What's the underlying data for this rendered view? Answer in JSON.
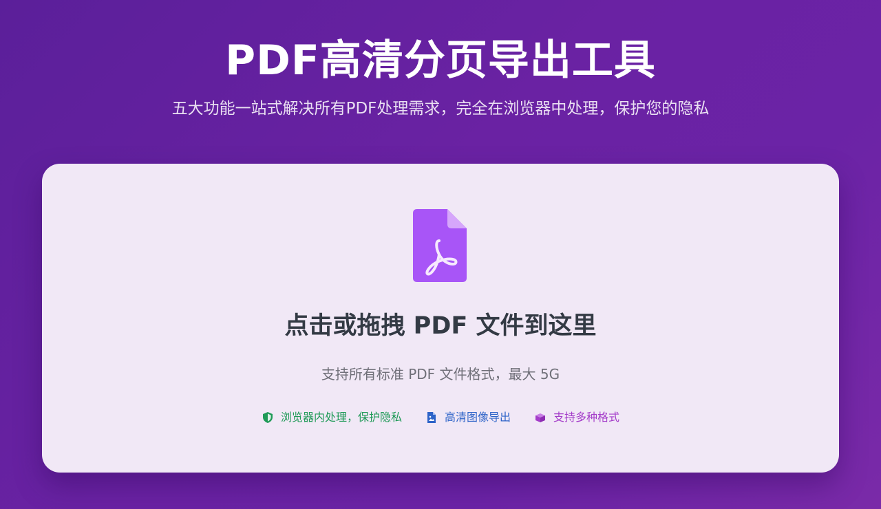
{
  "header": {
    "title": "PDF高清分页导出工具",
    "subtitle": "五大功能一站式解决所有PDF处理需求，完全在浏览器中处理，保护您的隐私"
  },
  "upload": {
    "icon": "pdf-file-icon",
    "title": "点击或拖拽 PDF 文件到这里",
    "hint": "支持所有标准 PDF 文件格式，最大 5G",
    "accent_color": "#a855f7"
  },
  "features": [
    {
      "icon": "shield-icon",
      "label": "浏览器内处理，保护隐私",
      "color": "#1f9a57"
    },
    {
      "icon": "image-file-icon",
      "label": "高清图像导出",
      "color": "#2d63c8"
    },
    {
      "icon": "box-icon",
      "label": "支持多种格式",
      "color": "#a43cc9"
    }
  ]
}
